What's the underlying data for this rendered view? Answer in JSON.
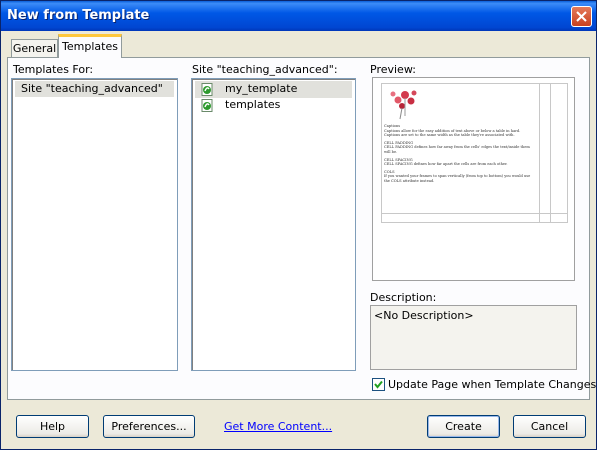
{
  "window": {
    "title": "New from Template"
  },
  "tabs": [
    {
      "label": "General"
    },
    {
      "label": "Templates"
    }
  ],
  "templates_for": {
    "label": "Templates For:",
    "items": [
      "Site \"teaching_advanced\""
    ]
  },
  "site_list": {
    "label": "Site \"teaching_advanced\":",
    "items": [
      "my_template",
      "templates"
    ]
  },
  "preview": {
    "label": "Preview:",
    "heading": "Captions",
    "lines": [
      "Captions allow for the easy addition of text above or below a table in hard. Captions are set to the same width as the table they're associated with.",
      "CELL PADDING",
      "CELL PADDING defines how far away from the cells' edges the text/inside them will be.",
      "CELL SPACING",
      "CELL SPACING defines how far apart the cells are from each other.",
      "COLS",
      "If you wanted your frames to span vertically (from top to bottom) you would use the COLS attribute instead."
    ]
  },
  "description": {
    "label": "Description:",
    "value": "<No Description>"
  },
  "update_checkbox": {
    "label": "Update Page when Template Changes",
    "checked": true
  },
  "buttons": {
    "help": "Help",
    "preferences": "Preferences...",
    "get_more": "Get More Content...",
    "create": "Create",
    "cancel": "Cancel"
  }
}
